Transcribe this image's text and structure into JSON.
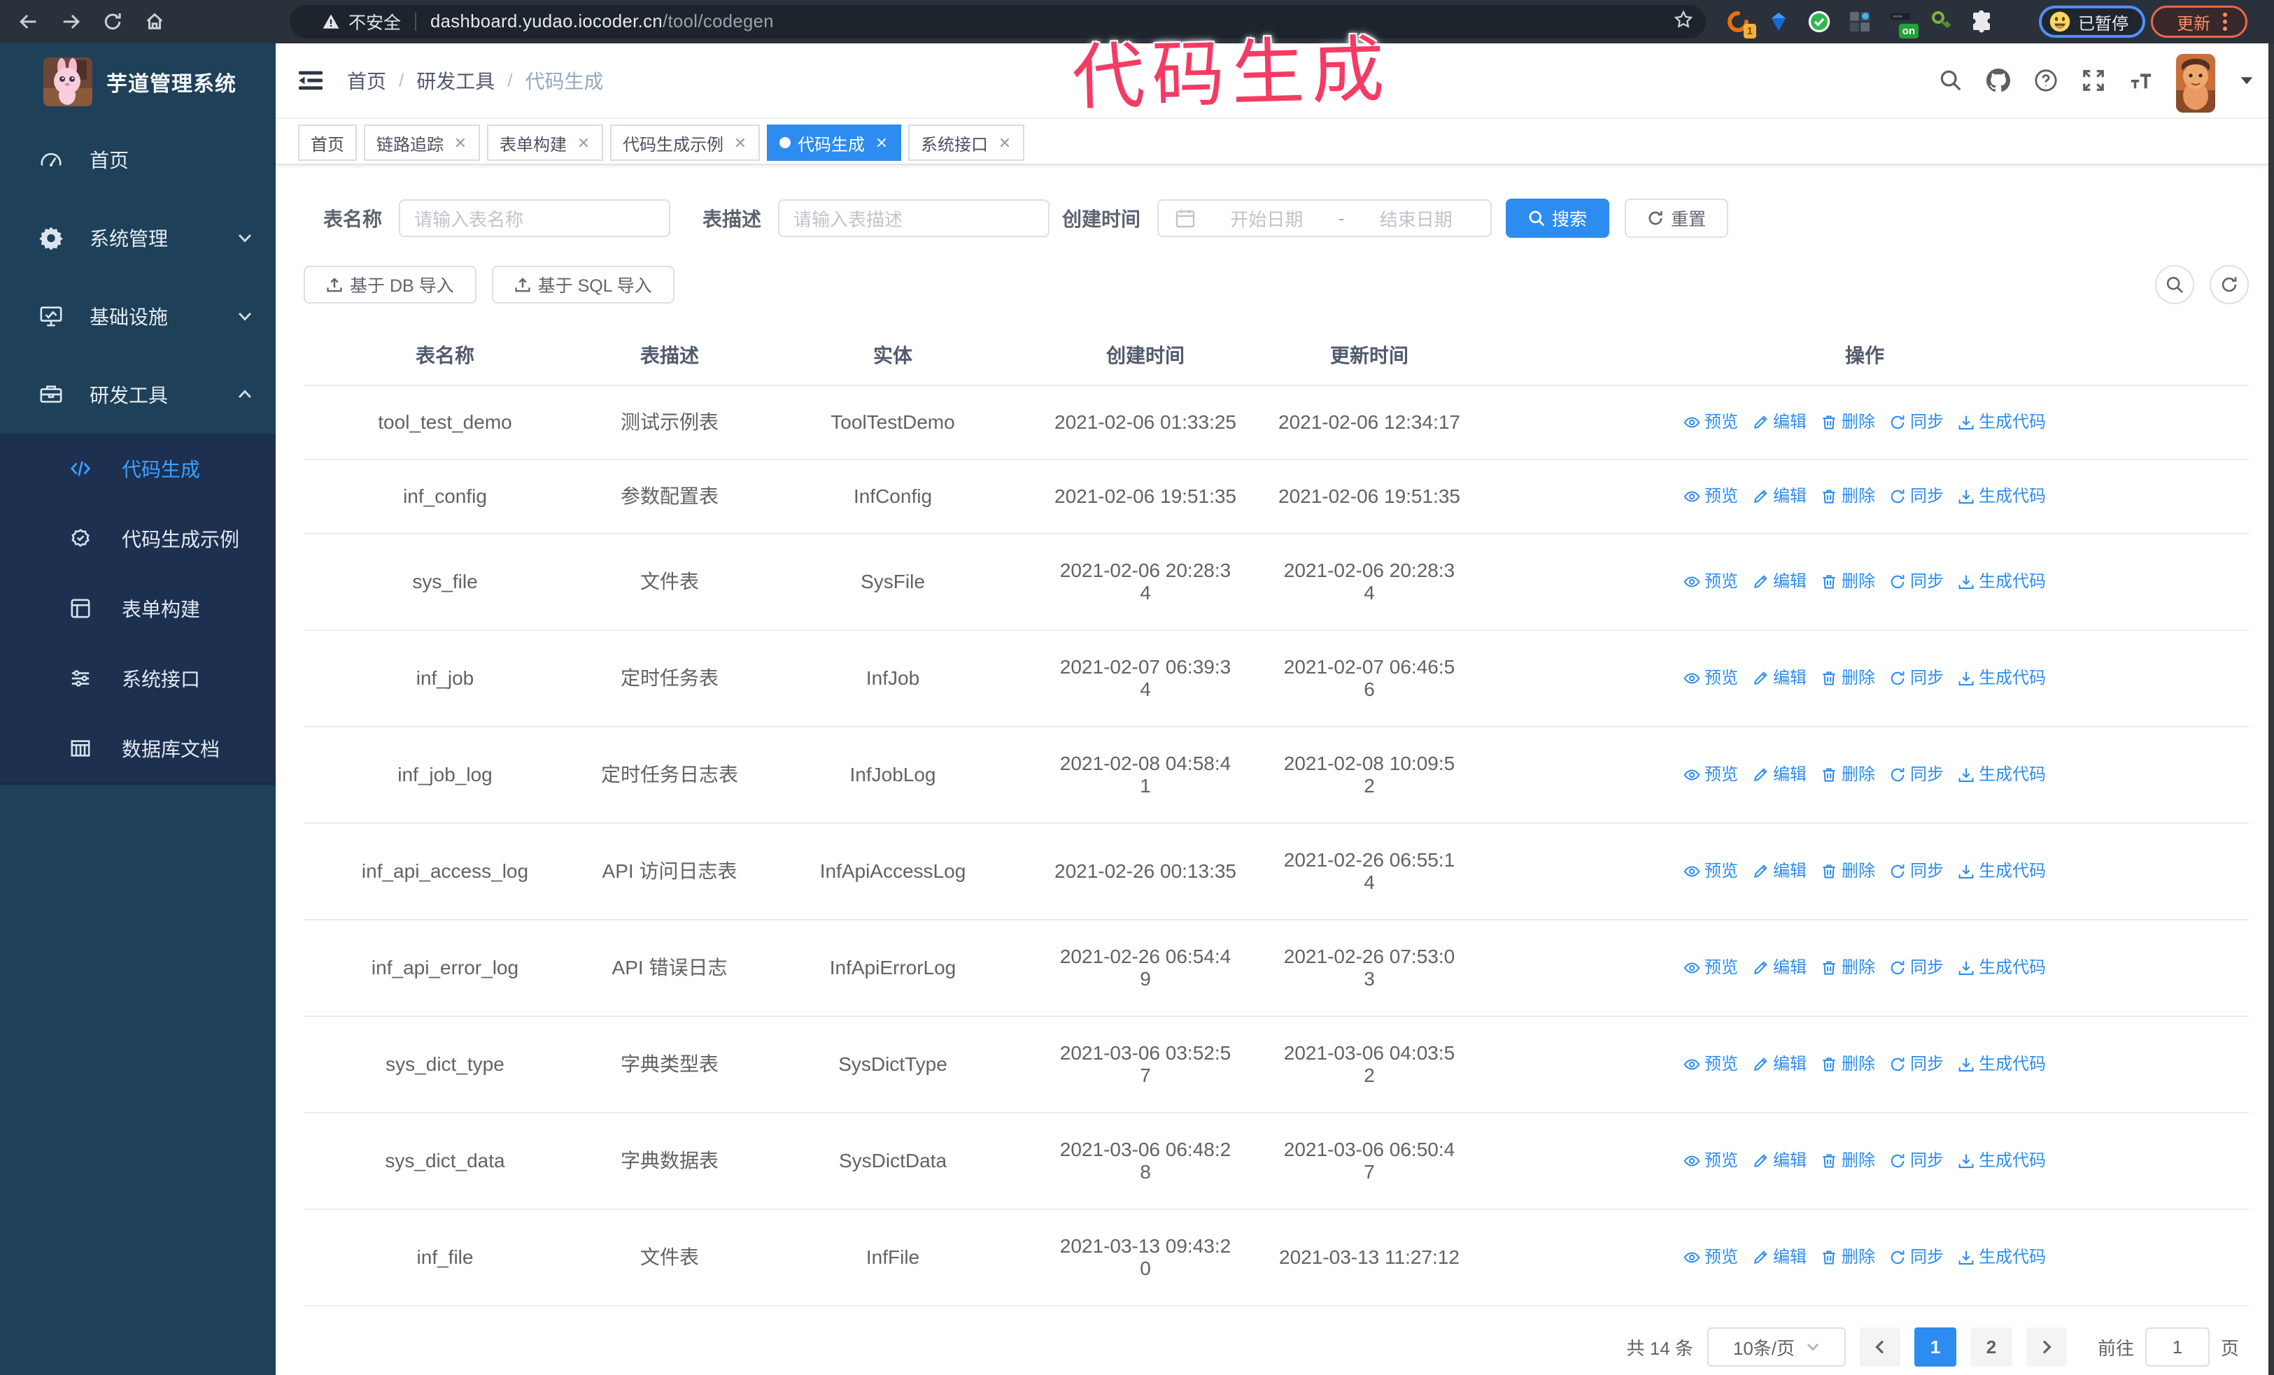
{
  "colors": {
    "primary": "#2d8cf0",
    "sidebar_bg": "#1e4058",
    "submenu_bg": "#1d3050",
    "chrome_bg": "#2a313b",
    "omnibox_bg": "#1d242c",
    "annotation_pink": "#f43b63",
    "table_header_text": "#515a6e",
    "table_cell_text": "#606266"
  },
  "browser": {
    "security_label": "不安全",
    "url_host": "dashboard.yudao.iocoder.cn",
    "url_path": "/tool/codegen",
    "extensions": [
      {
        "icon": "orange-swirl-extension-icon",
        "badge": "1",
        "badge_bg": "#f5b041",
        "badge_color": "#7a4a00"
      },
      {
        "icon": "blue-gem-extension-icon",
        "badge": ""
      },
      {
        "icon": "green-check-extension-icon",
        "badge": ""
      },
      {
        "icon": "grid-squares-extension-icon",
        "badge": ""
      },
      {
        "icon": "dark-switch-extension-icon",
        "badge": "on",
        "badge_bg": "#23a237",
        "badge_color": "#ffffff"
      },
      {
        "icon": "green-key-extension-icon",
        "badge": ""
      },
      {
        "icon": "puzzle-extension-icon",
        "badge": ""
      }
    ],
    "paused_chip_label": "已暂停",
    "update_button_label": "更新"
  },
  "annotation": {
    "text": "代码生成"
  },
  "sidebar": {
    "logo_title": "芋道管理系统",
    "menu": [
      {
        "label": "首页",
        "icon": "dashboard-icon",
        "chevron": "",
        "children": []
      },
      {
        "label": "系统管理",
        "icon": "gear-icon",
        "chevron": "down",
        "children": []
      },
      {
        "label": "基础设施",
        "icon": "infrastructure-icon",
        "chevron": "down",
        "children": []
      },
      {
        "label": "研发工具",
        "icon": "toolbox-icon",
        "chevron": "up",
        "children": [
          {
            "label": "代码生成",
            "icon": "code-icon",
            "active": true
          },
          {
            "label": "代码生成示例",
            "icon": "badge-check-icon",
            "active": false
          },
          {
            "label": "表单构建",
            "icon": "form-icon",
            "active": false
          },
          {
            "label": "系统接口",
            "icon": "sliders-icon",
            "active": false
          },
          {
            "label": "数据库文档",
            "icon": "table-doc-icon",
            "active": false
          }
        ]
      }
    ]
  },
  "navbar": {
    "breadcrumb": [
      "首页",
      "研发工具",
      "代码生成"
    ],
    "separator": "/",
    "right_icons": [
      "search-icon",
      "github-icon",
      "help-icon",
      "fullscreen-icon",
      "fontsize-icon"
    ]
  },
  "tabs": [
    {
      "label": "首页",
      "closable": false,
      "active": false
    },
    {
      "label": "链路追踪",
      "closable": true,
      "active": false
    },
    {
      "label": "表单构建",
      "closable": true,
      "active": false
    },
    {
      "label": "代码生成示例",
      "closable": true,
      "active": false
    },
    {
      "label": "代码生成",
      "closable": true,
      "active": true
    },
    {
      "label": "系统接口",
      "closable": true,
      "active": false
    }
  ],
  "filters": {
    "table_name_label": "表名称",
    "table_name_placeholder": "请输入表名称",
    "table_name_value": "",
    "table_desc_label": "表描述",
    "table_desc_placeholder": "请输入表描述",
    "table_desc_value": "",
    "create_time_label": "创建时间",
    "date_start_placeholder": "开始日期",
    "date_separator": "-",
    "date_end_placeholder": "结束日期",
    "search_label": "搜索",
    "reset_label": "重置"
  },
  "toolbar": {
    "import_db_label": "基于 DB 导入",
    "import_sql_label": "基于 SQL 导入"
  },
  "table": {
    "columns": [
      "表名称",
      "表描述",
      "实体",
      "创建时间",
      "更新时间",
      "操作"
    ],
    "actions": [
      {
        "icon": "eye-icon",
        "label": "预览"
      },
      {
        "icon": "edit-icon",
        "label": "编辑"
      },
      {
        "icon": "delete-icon",
        "label": "删除"
      },
      {
        "icon": "sync-icon",
        "label": "同步"
      },
      {
        "icon": "generate-icon",
        "label": "生成代码"
      }
    ],
    "rows": [
      {
        "name": "tool_test_demo",
        "desc": "测试示例表",
        "entity": "ToolTestDemo",
        "created": "2021-02-06 01:33:25",
        "updated": "2021-02-06 12:34:17"
      },
      {
        "name": "inf_config",
        "desc": "参数配置表",
        "entity": "InfConfig",
        "created": "2021-02-06 19:51:35",
        "updated": "2021-02-06 19:51:35"
      },
      {
        "name": "sys_file",
        "desc": "文件表",
        "entity": "SysFile",
        "created": "2021-02-06 20:28:3\n4",
        "updated": "2021-02-06 20:28:3\n4"
      },
      {
        "name": "inf_job",
        "desc": "定时任务表",
        "entity": "InfJob",
        "created": "2021-02-07 06:39:3\n4",
        "updated": "2021-02-07 06:46:5\n6"
      },
      {
        "name": "inf_job_log",
        "desc": "定时任务日志表",
        "entity": "InfJobLog",
        "created": "2021-02-08 04:58:4\n1",
        "updated": "2021-02-08 10:09:5\n2"
      },
      {
        "name": "inf_api_access_log",
        "desc": "API 访问日志表",
        "entity": "InfApiAccessLog",
        "created": "2021-02-26 00:13:35",
        "updated": "2021-02-26 06:55:1\n4"
      },
      {
        "name": "inf_api_error_log",
        "desc": "API 错误日志",
        "entity": "InfApiErrorLog",
        "created": "2021-02-26 06:54:4\n9",
        "updated": "2021-02-26 07:53:0\n3"
      },
      {
        "name": "sys_dict_type",
        "desc": "字典类型表",
        "entity": "SysDictType",
        "created": "2021-03-06 03:52:5\n7",
        "updated": "2021-03-06 04:03:5\n2"
      },
      {
        "name": "sys_dict_data",
        "desc": "字典数据表",
        "entity": "SysDictData",
        "created": "2021-03-06 06:48:2\n8",
        "updated": "2021-03-06 06:50:4\n7"
      },
      {
        "name": "inf_file",
        "desc": "文件表",
        "entity": "InfFile",
        "created": "2021-03-13 09:43:2\n0",
        "updated": "2021-03-13 11:27:12"
      }
    ]
  },
  "pagination": {
    "total_label": "共 14 条",
    "page_size_label": "10条/页",
    "pages": [
      "1",
      "2"
    ],
    "active_page": "1",
    "jump_label_before": "前往",
    "jump_value": "1",
    "jump_label_after": "页"
  }
}
